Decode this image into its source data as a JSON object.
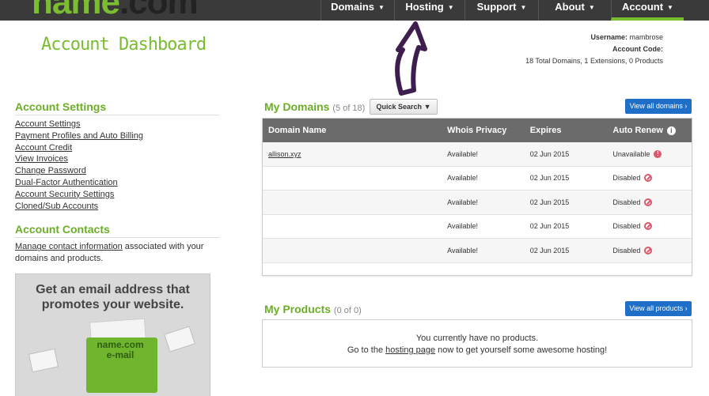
{
  "logo": {
    "text_a": "name",
    "text_b": ".com"
  },
  "nav": [
    {
      "label": "Domains"
    },
    {
      "label": "Hosting"
    },
    {
      "label": "Support"
    },
    {
      "label": "About"
    },
    {
      "label": "Account"
    }
  ],
  "header": {
    "title": "Account Dashboard",
    "username_label": "Username:",
    "username": "mambrose",
    "account_code_label": "Account Code:",
    "summary": "18 Total Domains, 1 Extensions, 0 Products"
  },
  "account_settings": {
    "heading": "Account Settings",
    "links": [
      "Account Settings",
      "Payment Profiles and Auto Billing",
      "Account Credit",
      "View Invoices",
      "Change Password",
      "Dual-Factor Authentication",
      "Account Security Settings",
      "Cloned/Sub Accounts"
    ]
  },
  "account_contacts": {
    "heading": "Account Contacts",
    "link": "Manage contact information",
    "text": " associated with your domains and products."
  },
  "promo": {
    "headline": "Get an email address that promotes your website.",
    "envelope_line1": "name.com",
    "envelope_line2": "e-mail"
  },
  "my_domains": {
    "title": "My Domains",
    "count": "(5 of 18)",
    "quick_search": "Quick Search",
    "view_all": "View all domains ›",
    "columns": [
      "Domain Name",
      "Whois Privacy",
      "Expires",
      "Auto Renew"
    ],
    "rows": [
      {
        "domain": "allison.xyz",
        "whois": "Available!",
        "expires": "02 Jun 2015",
        "renew": "Unavailable",
        "renew_icon": "warning"
      },
      {
        "domain": "",
        "whois": "Available!",
        "expires": "02 Jun 2015",
        "renew": "Disabled",
        "renew_icon": "disabled"
      },
      {
        "domain": "",
        "whois": "Available!",
        "expires": "02 Jun 2015",
        "renew": "Disabled",
        "renew_icon": "disabled"
      },
      {
        "domain": "",
        "whois": "Available!",
        "expires": "02 Jun 2015",
        "renew": "Disabled",
        "renew_icon": "disabled"
      },
      {
        "domain": "",
        "whois": "Available!",
        "expires": "02 Jun 2015",
        "renew": "Disabled",
        "renew_icon": "disabled"
      }
    ]
  },
  "my_products": {
    "title": "My Products",
    "count": "(0 of 0)",
    "view_all": "View all products ›",
    "empty_line1": "You currently have no products.",
    "empty_pre": "Go to the ",
    "empty_link": "hosting page",
    "empty_post": " now to get yourself some awesome hosting!"
  },
  "colors": {
    "brand_green": "#7bbd31",
    "nav_bg": "#3a3a3a",
    "button_blue": "#1f6fc9",
    "alert_red": "#d85a6a"
  }
}
